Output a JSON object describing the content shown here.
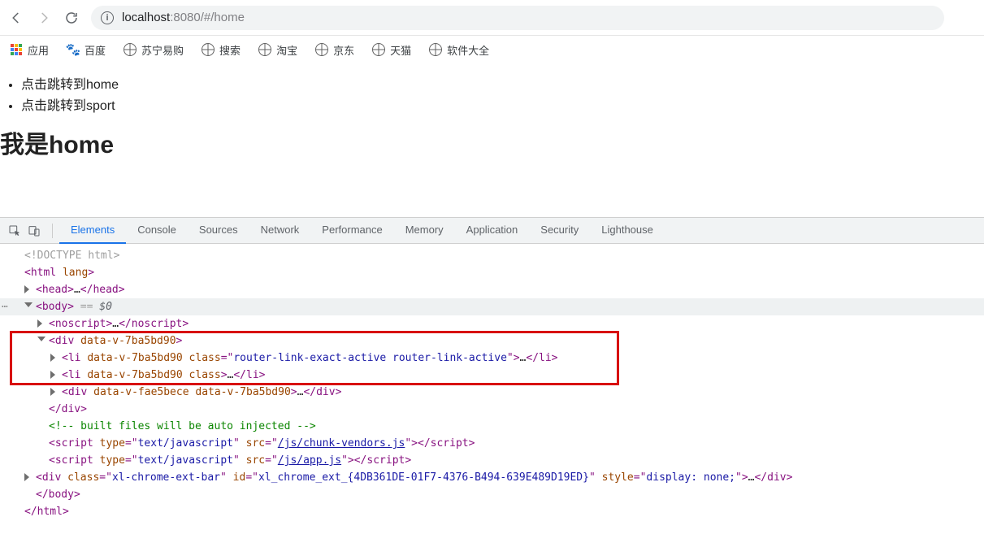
{
  "browser": {
    "url_host": "localhost",
    "url_port": ":8080",
    "url_path": "/#/home"
  },
  "bookmarks": {
    "apps": "应用",
    "items": [
      {
        "label": "百度"
      },
      {
        "label": "苏宁易购"
      },
      {
        "label": "搜索"
      },
      {
        "label": "淘宝"
      },
      {
        "label": "京东"
      },
      {
        "label": "天猫"
      },
      {
        "label": "软件大全"
      }
    ]
  },
  "page": {
    "links": [
      "点击跳转到home",
      "点击跳转到sport"
    ],
    "heading": "我是home"
  },
  "devtools": {
    "tabs": [
      "Elements",
      "Console",
      "Sources",
      "Network",
      "Performance",
      "Memory",
      "Application",
      "Security",
      "Lighthouse"
    ],
    "active_tab_index": 0,
    "dom": {
      "l0": "<!DOCTYPE html>",
      "l1_open": "<html ",
      "l1_attr": "lang",
      "l1_close": ">",
      "l2a": "<head>",
      "l2b": "…",
      "l2c": "</head>",
      "l3a": "<body>",
      "l3b": " == ",
      "l3c": "$0",
      "l4a": "<noscript>",
      "l4b": "…",
      "l4c": "</noscript>",
      "l5": "<div data-v-7ba5bd90>",
      "l6a": "<li ",
      "l6b": "data-v-7ba5bd90",
      "l6c": " class",
      "l6d": "=\"",
      "l6e": "router-link-exact-active router-link-active",
      "l6f": "\">",
      "l6g": "…",
      "l6h": "</li>",
      "l7a": "<li ",
      "l7b": "data-v-7ba5bd90",
      "l7c": " class",
      "l7d": ">",
      "l7e": "…",
      "l7f": "</li>",
      "l8a": "<div ",
      "l8b": "data-v-fae5bece",
      "l8c": " data-v-7ba5bd90",
      "l8d": ">",
      "l8e": "…",
      "l8f": "</div>",
      "l9": "</div>",
      "l10": "<!-- built files will be auto injected -->",
      "l11a": "<script ",
      "l11b": "type",
      "l11c": "=\"",
      "l11d": "text/javascript",
      "l11e": "\" ",
      "l11f": "src",
      "l11g": "=\"",
      "l11h": "/js/chunk-vendors.js",
      "l11i": "\">",
      "l11j": "</script>",
      "l12a": "<script ",
      "l12b": "type",
      "l12c": "=\"",
      "l12d": "text/javascript",
      "l12e": "\" ",
      "l12f": "src",
      "l12g": "=\"",
      "l12h": "/js/app.js",
      "l12i": "\">",
      "l12j": "</script>",
      "l13a": "<div ",
      "l13b": "class",
      "l13c": "=\"",
      "l13d": "xl-chrome-ext-bar",
      "l13e": "\" ",
      "l13f": "id",
      "l13g": "=\"",
      "l13h": "xl_chrome_ext_{4DB361DE-01F7-4376-B494-639E489D19ED}",
      "l13i": "\" ",
      "l13j": "style",
      "l13k": "=\"",
      "l13l": "display: none;",
      "l13m": "\">",
      "l13n": "…",
      "l13o": "</div>",
      "l14": "</body>",
      "l15": "</html>"
    }
  }
}
